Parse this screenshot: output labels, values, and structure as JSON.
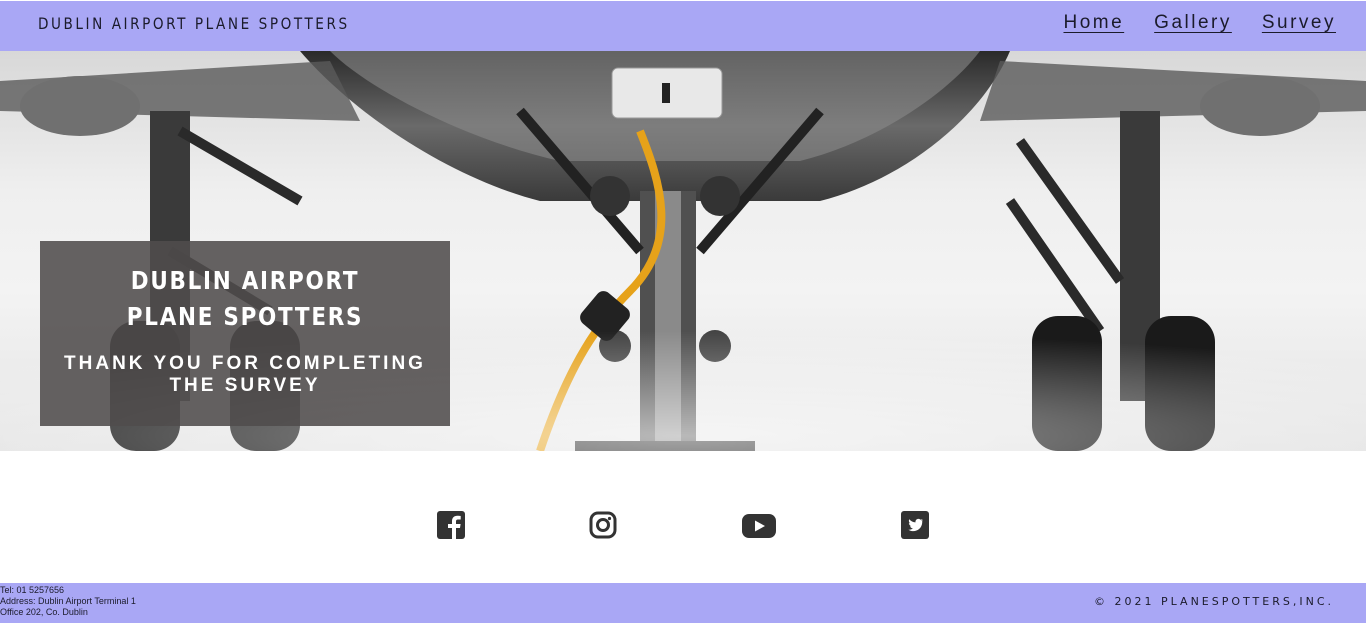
{
  "header": {
    "brand": "DUBLIN AIRPORT PLANE SPOTTERS",
    "nav": [
      {
        "label": "Home"
      },
      {
        "label": "Gallery"
      },
      {
        "label": "Survey"
      }
    ]
  },
  "hero": {
    "title": "DUBLIN AIRPORT PLANE SPOTTERS",
    "subtitle": "THANK YOU FOR COMPLETING THE SURVEY",
    "image": "aircraft-landing-gear-photo"
  },
  "social": {
    "icons": [
      "facebook-icon",
      "instagram-icon",
      "youtube-icon",
      "twitter-icon"
    ],
    "color": "#333333"
  },
  "footer": {
    "contact": [
      "Tel: 01 5257656",
      "Address: Dublin Airport Terminal 1",
      "Office 202, Co. Dublin"
    ],
    "copyright": "© 2021 PLANESPOTTERS,INC."
  },
  "colors": {
    "accent": "#a9a7f5",
    "overlay": "#504c4c"
  }
}
